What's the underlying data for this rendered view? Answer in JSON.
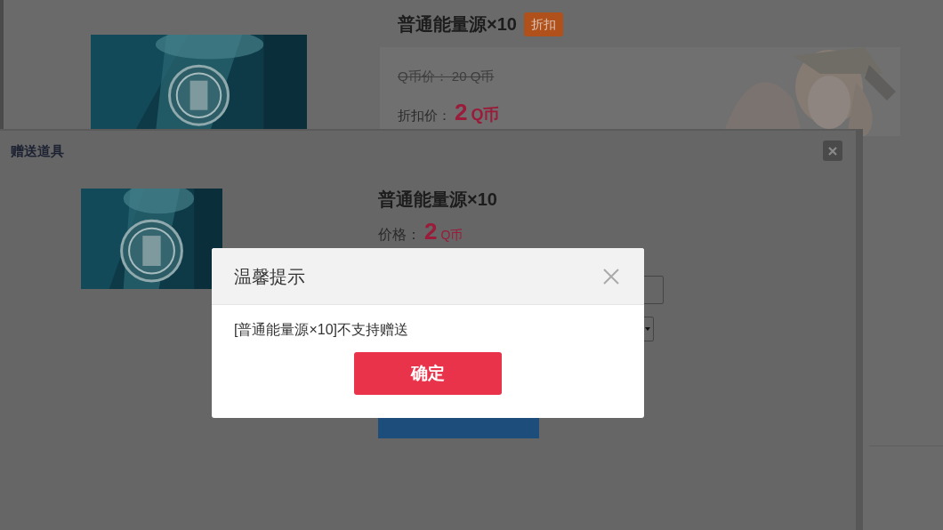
{
  "page": {
    "product": {
      "title": "普通能量源×10",
      "badge": "折扣",
      "original_price": "Q币价： 20 Q币",
      "discount_label": "折扣价：",
      "discount_price": "2",
      "discount_currency": "Q币"
    }
  },
  "gift_dialog": {
    "title": "赠送道具",
    "product_title": "普通能量源×10",
    "price_label": "价格：",
    "price": "2",
    "currency": "Q币"
  },
  "alert": {
    "title": "温馨提示",
    "message": "[普通能量源×10]不支持赠送",
    "button": "确定"
  }
}
